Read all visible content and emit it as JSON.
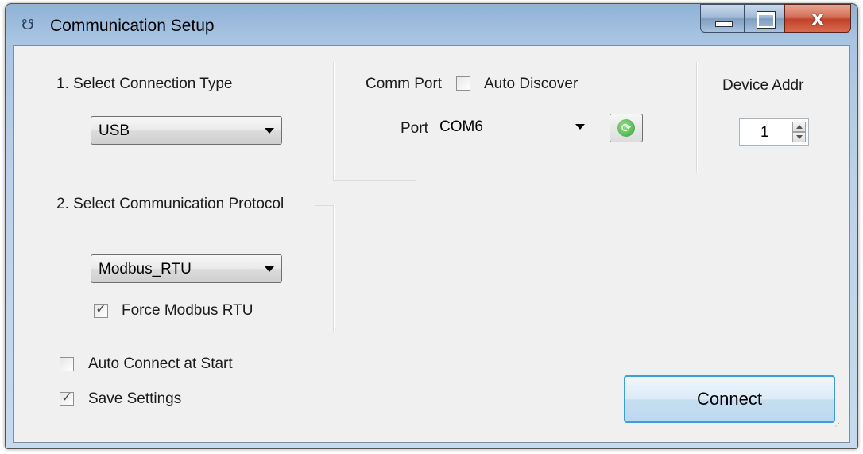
{
  "window": {
    "title": "Communication Setup",
    "app_icon": "plug-icon",
    "buttons": {
      "minimize": "minimize-icon",
      "maximize": "maximize-icon",
      "close": "x"
    }
  },
  "connection": {
    "label": "1. Select Connection Type",
    "value": "USB"
  },
  "protocol": {
    "label": "2. Select Communication Protocol",
    "value": "Modbus_RTU",
    "force_label": "Force Modbus RTU",
    "force_checked": true
  },
  "comm_port": {
    "label": "Comm Port",
    "auto_discover_label": "Auto Discover",
    "auto_discover_checked": false,
    "port_label": "Port",
    "port_value": "COM6",
    "refresh_icon": "refresh-icon"
  },
  "device": {
    "label": "Device Addr",
    "value": "1"
  },
  "options": {
    "auto_connect_label": "Auto Connect at Start",
    "auto_connect_checked": false,
    "save_settings_label": "Save Settings",
    "save_settings_checked": true
  },
  "actions": {
    "connect_label": "Connect"
  }
}
